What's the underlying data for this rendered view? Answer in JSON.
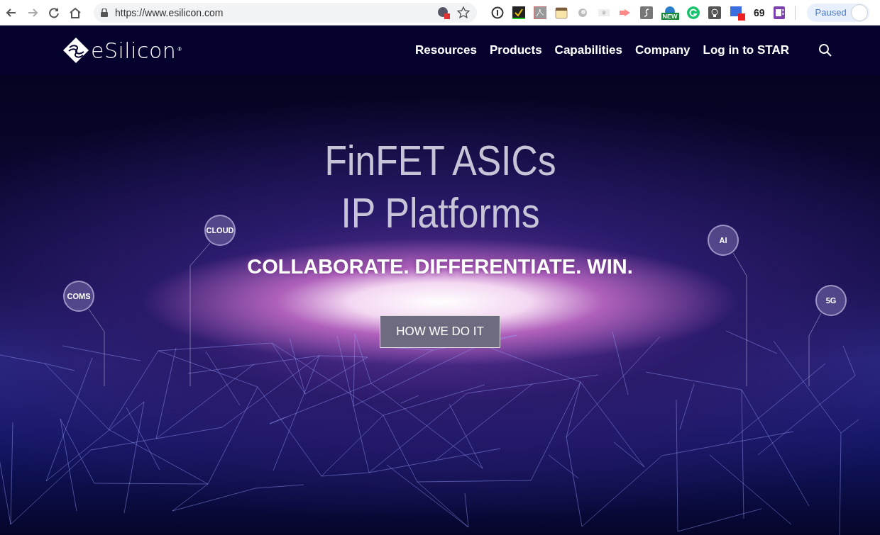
{
  "browser": {
    "url": "https://www.esilicon.com",
    "new_badge": "NEW",
    "count": "69",
    "profile_label": "Paused"
  },
  "site": {
    "logo": "eSilicon",
    "logo_mark": "®",
    "nav": [
      {
        "label": "Resources"
      },
      {
        "label": "Products"
      },
      {
        "label": "Capabilities"
      },
      {
        "label": "Company"
      },
      {
        "label": "Log in to STAR"
      }
    ],
    "hero": {
      "headline": [
        "FinFET ASICs",
        "IP Platforms"
      ],
      "tagline": "COLLABORATE. DIFFERENTIATE. WIN.",
      "button": "HOW WE DO IT",
      "markets": [
        {
          "label": "CLOUD"
        },
        {
          "label": "COMS"
        },
        {
          "label": "AI"
        },
        {
          "label": "5G"
        }
      ]
    }
  }
}
